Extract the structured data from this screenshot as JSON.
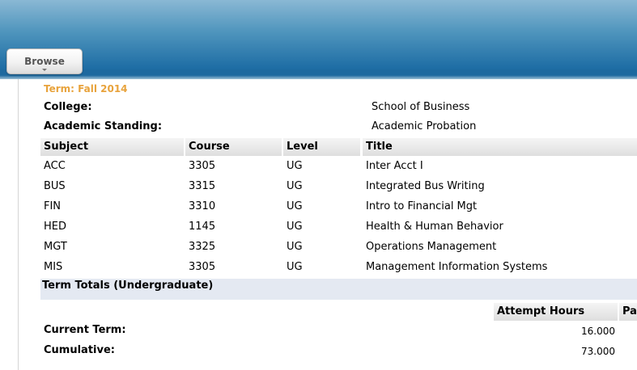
{
  "header": {
    "browse_label": "Browse"
  },
  "term": {
    "title": "Term: Fall 2014",
    "college_label": "College:",
    "college_value": "School of Business",
    "standing_label": "Academic Standing:",
    "standing_value": "Academic Probation"
  },
  "courses": {
    "columns": [
      "Subject",
      "Course",
      "Level",
      "Title"
    ],
    "rows": [
      {
        "subject": "ACC",
        "course": "3305",
        "level": "UG",
        "title": "Inter Acct I"
      },
      {
        "subject": "BUS",
        "course": "3315",
        "level": "UG",
        "title": "Integrated Bus Writing"
      },
      {
        "subject": "FIN",
        "course": "3310",
        "level": "UG",
        "title": "Intro to Financial Mgt"
      },
      {
        "subject": "HED",
        "course": "1145",
        "level": "UG",
        "title": "Health & Human Behavior"
      },
      {
        "subject": "MGT",
        "course": "3325",
        "level": "UG",
        "title": "Operations Management"
      },
      {
        "subject": "MIS",
        "course": "3305",
        "level": "UG",
        "title": "Management Information Systems"
      }
    ]
  },
  "totals": {
    "title": "Term Totals (Undergraduate)",
    "columns": [
      "Attempt Hours",
      "Pa"
    ],
    "rows": [
      {
        "label": "Current Term:",
        "attempt_hours": "16.000"
      },
      {
        "label": "Cumulative:",
        "attempt_hours": "73.000"
      }
    ]
  },
  "colors": {
    "header_blue": "#1f6ea5",
    "term_title": "#e8a33c",
    "totals_band": "#e4e9f2"
  }
}
